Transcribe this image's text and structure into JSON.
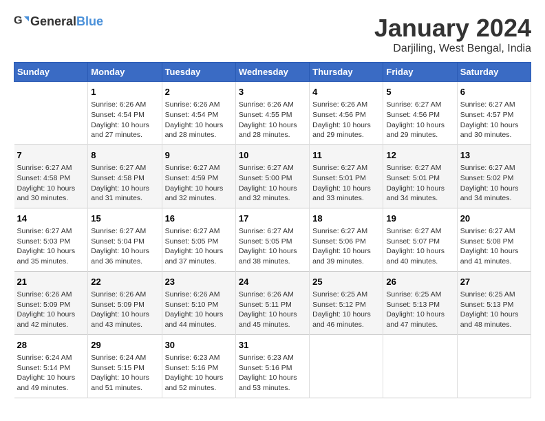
{
  "header": {
    "logo_general": "General",
    "logo_blue": "Blue",
    "month_title": "January 2024",
    "location": "Darjiling, West Bengal, India"
  },
  "weekdays": [
    "Sunday",
    "Monday",
    "Tuesday",
    "Wednesday",
    "Thursday",
    "Friday",
    "Saturday"
  ],
  "weeks": [
    [
      {
        "day": "",
        "info": ""
      },
      {
        "day": "1",
        "info": "Sunrise: 6:26 AM\nSunset: 4:54 PM\nDaylight: 10 hours\nand 27 minutes."
      },
      {
        "day": "2",
        "info": "Sunrise: 6:26 AM\nSunset: 4:54 PM\nDaylight: 10 hours\nand 28 minutes."
      },
      {
        "day": "3",
        "info": "Sunrise: 6:26 AM\nSunset: 4:55 PM\nDaylight: 10 hours\nand 28 minutes."
      },
      {
        "day": "4",
        "info": "Sunrise: 6:26 AM\nSunset: 4:56 PM\nDaylight: 10 hours\nand 29 minutes."
      },
      {
        "day": "5",
        "info": "Sunrise: 6:27 AM\nSunset: 4:56 PM\nDaylight: 10 hours\nand 29 minutes."
      },
      {
        "day": "6",
        "info": "Sunrise: 6:27 AM\nSunset: 4:57 PM\nDaylight: 10 hours\nand 30 minutes."
      }
    ],
    [
      {
        "day": "7",
        "info": "Sunrise: 6:27 AM\nSunset: 4:58 PM\nDaylight: 10 hours\nand 30 minutes."
      },
      {
        "day": "8",
        "info": "Sunrise: 6:27 AM\nSunset: 4:58 PM\nDaylight: 10 hours\nand 31 minutes."
      },
      {
        "day": "9",
        "info": "Sunrise: 6:27 AM\nSunset: 4:59 PM\nDaylight: 10 hours\nand 32 minutes."
      },
      {
        "day": "10",
        "info": "Sunrise: 6:27 AM\nSunset: 5:00 PM\nDaylight: 10 hours\nand 32 minutes."
      },
      {
        "day": "11",
        "info": "Sunrise: 6:27 AM\nSunset: 5:01 PM\nDaylight: 10 hours\nand 33 minutes."
      },
      {
        "day": "12",
        "info": "Sunrise: 6:27 AM\nSunset: 5:01 PM\nDaylight: 10 hours\nand 34 minutes."
      },
      {
        "day": "13",
        "info": "Sunrise: 6:27 AM\nSunset: 5:02 PM\nDaylight: 10 hours\nand 34 minutes."
      }
    ],
    [
      {
        "day": "14",
        "info": "Sunrise: 6:27 AM\nSunset: 5:03 PM\nDaylight: 10 hours\nand 35 minutes."
      },
      {
        "day": "15",
        "info": "Sunrise: 6:27 AM\nSunset: 5:04 PM\nDaylight: 10 hours\nand 36 minutes."
      },
      {
        "day": "16",
        "info": "Sunrise: 6:27 AM\nSunset: 5:05 PM\nDaylight: 10 hours\nand 37 minutes."
      },
      {
        "day": "17",
        "info": "Sunrise: 6:27 AM\nSunset: 5:05 PM\nDaylight: 10 hours\nand 38 minutes."
      },
      {
        "day": "18",
        "info": "Sunrise: 6:27 AM\nSunset: 5:06 PM\nDaylight: 10 hours\nand 39 minutes."
      },
      {
        "day": "19",
        "info": "Sunrise: 6:27 AM\nSunset: 5:07 PM\nDaylight: 10 hours\nand 40 minutes."
      },
      {
        "day": "20",
        "info": "Sunrise: 6:27 AM\nSunset: 5:08 PM\nDaylight: 10 hours\nand 41 minutes."
      }
    ],
    [
      {
        "day": "21",
        "info": "Sunrise: 6:26 AM\nSunset: 5:09 PM\nDaylight: 10 hours\nand 42 minutes."
      },
      {
        "day": "22",
        "info": "Sunrise: 6:26 AM\nSunset: 5:09 PM\nDaylight: 10 hours\nand 43 minutes."
      },
      {
        "day": "23",
        "info": "Sunrise: 6:26 AM\nSunset: 5:10 PM\nDaylight: 10 hours\nand 44 minutes."
      },
      {
        "day": "24",
        "info": "Sunrise: 6:26 AM\nSunset: 5:11 PM\nDaylight: 10 hours\nand 45 minutes."
      },
      {
        "day": "25",
        "info": "Sunrise: 6:25 AM\nSunset: 5:12 PM\nDaylight: 10 hours\nand 46 minutes."
      },
      {
        "day": "26",
        "info": "Sunrise: 6:25 AM\nSunset: 5:13 PM\nDaylight: 10 hours\nand 47 minutes."
      },
      {
        "day": "27",
        "info": "Sunrise: 6:25 AM\nSunset: 5:13 PM\nDaylight: 10 hours\nand 48 minutes."
      }
    ],
    [
      {
        "day": "28",
        "info": "Sunrise: 6:24 AM\nSunset: 5:14 PM\nDaylight: 10 hours\nand 49 minutes."
      },
      {
        "day": "29",
        "info": "Sunrise: 6:24 AM\nSunset: 5:15 PM\nDaylight: 10 hours\nand 51 minutes."
      },
      {
        "day": "30",
        "info": "Sunrise: 6:23 AM\nSunset: 5:16 PM\nDaylight: 10 hours\nand 52 minutes."
      },
      {
        "day": "31",
        "info": "Sunrise: 6:23 AM\nSunset: 5:16 PM\nDaylight: 10 hours\nand 53 minutes."
      },
      {
        "day": "",
        "info": ""
      },
      {
        "day": "",
        "info": ""
      },
      {
        "day": "",
        "info": ""
      }
    ]
  ]
}
